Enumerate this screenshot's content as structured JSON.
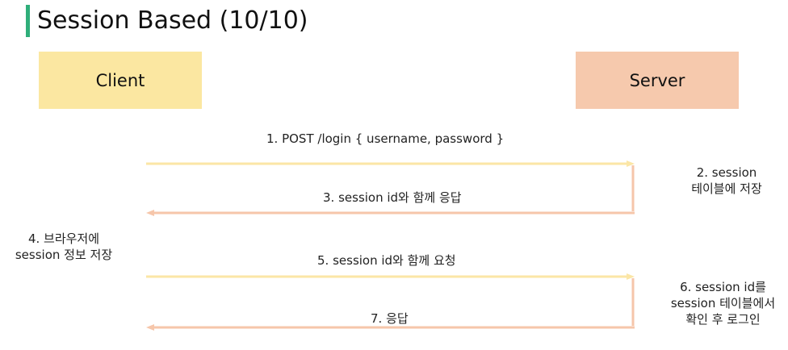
{
  "title": "Session Based (10/10)",
  "actors": {
    "client": "Client",
    "server": "Server"
  },
  "messages": {
    "m1": "1. POST /login { username, password }",
    "m3": "3. session id와 함께 응답",
    "m5": "5. session id와 함께 요청",
    "m7": "7. 응답"
  },
  "notes": {
    "n2_line1": "2. session",
    "n2_line2": "테이블에 저장",
    "n4_line1": "4. 브라우저에",
    "n4_line2": "session 정보 저장",
    "n6_line1": "6. session id를",
    "n6_line2": "session 테이블에서",
    "n6_line3": "확인 후 로그인"
  },
  "colors": {
    "accent_bar": "#2fae7a",
    "client_box": "#fbe7a1",
    "server_box": "#f6c9ad",
    "request_arrow": "#fbe6a6",
    "response_arrow": "#f6c6aa"
  }
}
